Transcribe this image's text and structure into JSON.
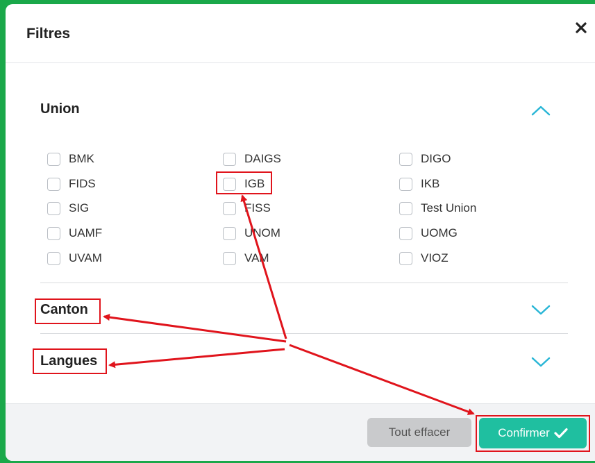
{
  "dialog": {
    "title": "Filtres",
    "close_icon": "close-icon"
  },
  "sections": {
    "union": {
      "title": "Union",
      "expanded": true,
      "options": [
        "BMK",
        "DAIGS",
        "DIGO",
        "FIDS",
        "IGB",
        "IKB",
        "SIG",
        "FISS",
        "Test Union",
        "UAMF",
        "UNOM",
        "UOMG",
        "UVAM",
        "VAM",
        "VIOZ"
      ]
    },
    "canton": {
      "title": "Canton",
      "expanded": false
    },
    "langues": {
      "title": "Langues",
      "expanded": false
    }
  },
  "footer": {
    "clear_label": "Tout effacer",
    "confirm_label": "Confirmer"
  },
  "colors": {
    "accent": "#1fbfa0",
    "chevron": "#29b6d6",
    "annotation": "#e0141c",
    "frame": "#1aa84a"
  }
}
